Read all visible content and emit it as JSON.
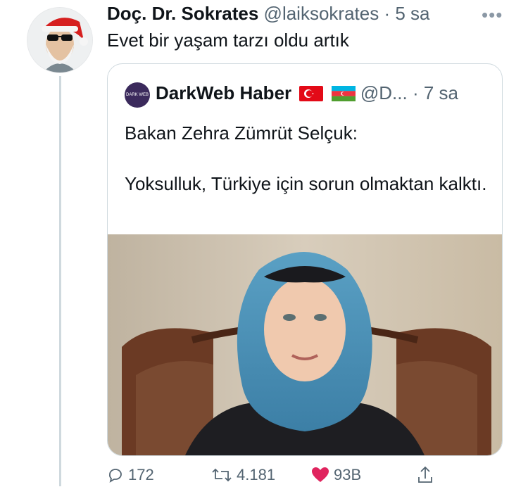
{
  "tweet": {
    "author_name": "Doç. Dr. Sokrates",
    "author_handle": "@laiksokrates",
    "separator": "·",
    "time": "5 sa",
    "more_glyph": "•••",
    "text": "Evet bir yaşam tarzı oldu artık",
    "avatar_icon": "santa-sokrates-avatar"
  },
  "quoted": {
    "author_name": "DarkWeb Haber",
    "author_handle": "@D...",
    "separator": "·",
    "time": "7 sa",
    "avatar_label": "DARK WEB",
    "flags": [
      "turkey-flag-icon",
      "azerbaijan-flag-icon"
    ],
    "text": "Bakan Zehra Zümrüt Selçuk:\n\nYoksulluk, Türkiye için sorun olmaktan kalktı."
  },
  "actions": {
    "reply_count": "172",
    "retweet_count": "4.181",
    "like_count": "93B",
    "icons": [
      "reply-icon",
      "retweet-icon",
      "like-icon",
      "share-icon"
    ],
    "like_color": "#e0245e",
    "muted_color": "#536471"
  }
}
